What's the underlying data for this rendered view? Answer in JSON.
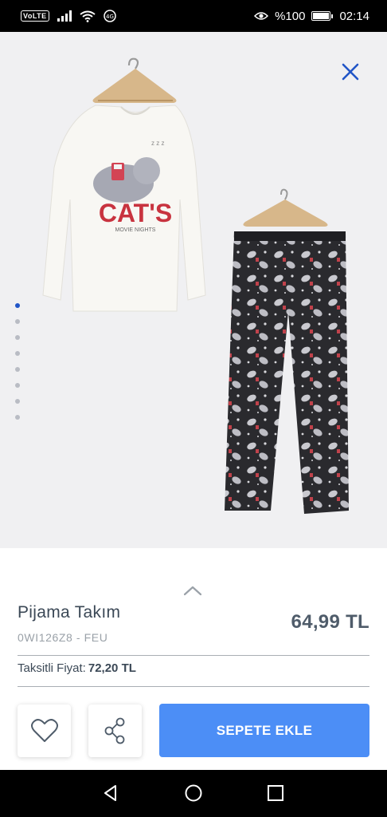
{
  "status_bar": {
    "volte": "VoLTE",
    "battery": "%100",
    "time": "02:14",
    "data_badge": "4G"
  },
  "product": {
    "title": "Pijama Takım",
    "code": "0WI126Z8 - FEU",
    "price": "64,99 TL",
    "installment_label": "Taksitli Fiyat:",
    "installment_price": "72,20 TL",
    "add_to_cart_label": "SEPETE EKLE",
    "print_text": "CAT'S",
    "print_subtext": "MOVIE NIGHTS"
  },
  "gallery": {
    "image_count": 8,
    "active_index": 0
  },
  "colors": {
    "accent": "#4c8ef6",
    "close": "#2155c7",
    "active_dot": "#2155c7",
    "price": "#4f5c6a"
  }
}
